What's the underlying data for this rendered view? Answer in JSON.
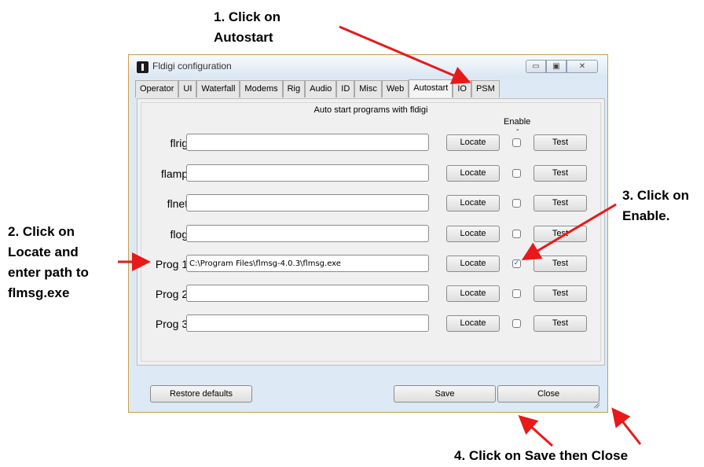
{
  "annotations": {
    "step1_line1": "1. Click on",
    "step1_line2": "Autostart",
    "step2_line1": "2. Click on",
    "step2_line2": "Locate and",
    "step2_line3": "enter path to",
    "step2_line4": "flmsg.exe",
    "step3_line1": "3. Click on",
    "step3_line2": "Enable.",
    "step4": "4. Click on Save then Close"
  },
  "window": {
    "title": "Fldigi configuration",
    "controls": {
      "minimize": "▭",
      "maximize": "▣",
      "close": "✕"
    }
  },
  "tabs": [
    {
      "label": "Operator"
    },
    {
      "label": "UI"
    },
    {
      "label": "Waterfall"
    },
    {
      "label": "Modems"
    },
    {
      "label": "Rig"
    },
    {
      "label": "Audio"
    },
    {
      "label": "ID"
    },
    {
      "label": "Misc"
    },
    {
      "label": "Web"
    },
    {
      "label": "Autostart",
      "active": true
    },
    {
      "label": "IO"
    },
    {
      "label": "PSM"
    }
  ],
  "panel": {
    "title": "Auto start programs with fldigi",
    "enable_header": "Enable",
    "enable_dash": "-"
  },
  "programs": [
    {
      "label": "flrig:",
      "path": "",
      "locate": "Locate",
      "enabled": false,
      "test": "Test"
    },
    {
      "label": "flamp:",
      "path": "",
      "locate": "Locate",
      "enabled": false,
      "test": "Test"
    },
    {
      "label": "flnet:",
      "path": "",
      "locate": "Locate",
      "enabled": false,
      "test": "Test"
    },
    {
      "label": "flog:",
      "path": "",
      "locate": "Locate",
      "enabled": false,
      "test": "Test"
    },
    {
      "label": "Prog 1:",
      "path": "C:\\Program Files\\flmsg-4.0.3\\flmsg.exe",
      "locate": "Locate",
      "enabled": true,
      "test": "Test"
    },
    {
      "label": "Prog 2:",
      "path": "",
      "locate": "Locate",
      "enabled": false,
      "test": "Test"
    },
    {
      "label": "Prog 3:",
      "path": "",
      "locate": "Locate",
      "enabled": false,
      "test": "Test"
    }
  ],
  "footer": {
    "restore": "Restore defaults",
    "save": "Save",
    "close": "Close"
  },
  "colors": {
    "arrow": "#e8191a",
    "window_bg": "#dde9f5",
    "panel_bg": "#f0f0f0"
  }
}
